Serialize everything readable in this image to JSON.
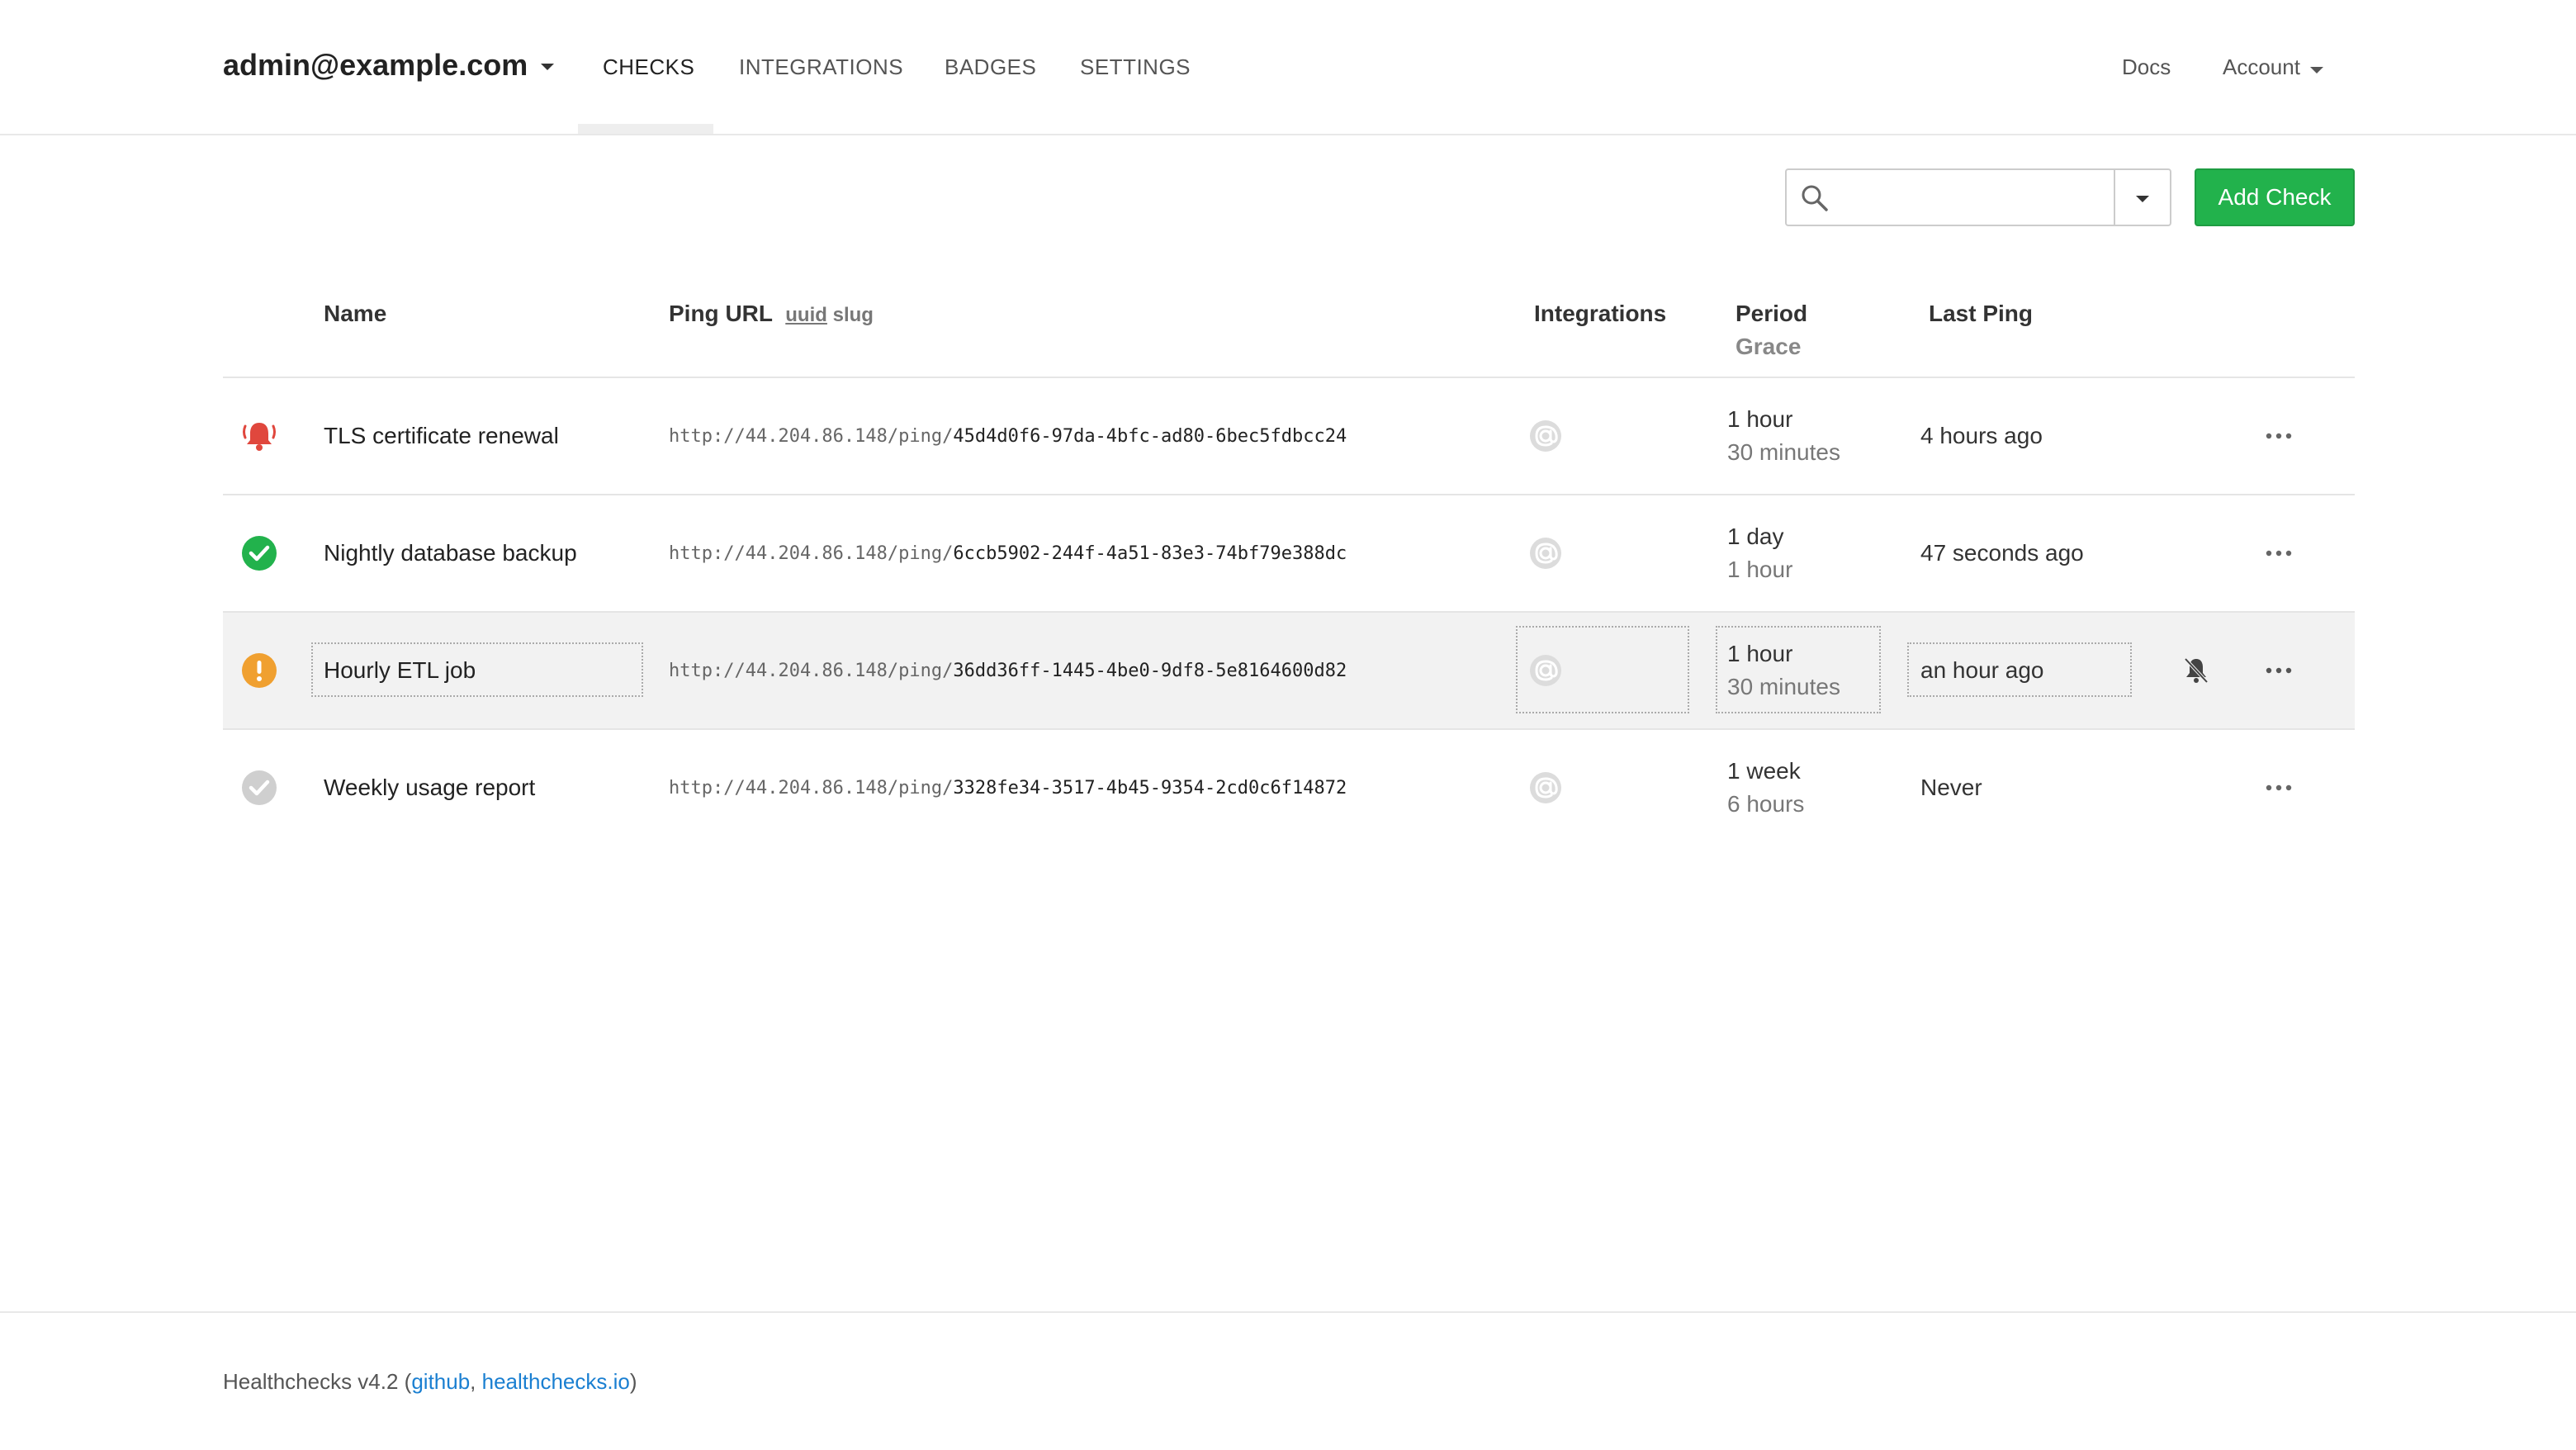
{
  "navbar": {
    "brand": "admin@example.com",
    "tabs": [
      "CHECKS",
      "INTEGRATIONS",
      "BADGES",
      "SETTINGS"
    ],
    "active_tab": "CHECKS",
    "docs": "Docs",
    "account": "Account"
  },
  "toolbar": {
    "search_value": "",
    "search_placeholder": "",
    "add_check": "Add Check",
    "accent_color": "#22b24c"
  },
  "table": {
    "headers": {
      "name": "Name",
      "ping_url": "Ping URL",
      "url_uuid": "uuid",
      "url_slug": "slug",
      "integrations": "Integrations",
      "period": "Period",
      "grace": "Grace",
      "last_ping": "Last Ping"
    },
    "rows": [
      {
        "status": "down",
        "status_icon": "bell-alert-icon",
        "status_color": "#e0473d",
        "name": "TLS certificate renewal",
        "url_base": "http://44.204.86.148/ping/",
        "url_id": "45d4d0f6-97da-4bfc-ad80-6bec5fdbcc24",
        "period": "1 hour",
        "grace": "30 minutes",
        "last_ping": "4 hours ago"
      },
      {
        "status": "up",
        "status_icon": "check-circle-icon",
        "status_color": "#22b24c",
        "name": "Nightly database backup",
        "url_base": "http://44.204.86.148/ping/",
        "url_id": "6ccb5902-244f-4a51-83e3-74bf79e388dc",
        "period": "1 day",
        "grace": "1 hour",
        "last_ping": "47 seconds ago"
      },
      {
        "status": "grace",
        "status_icon": "exclamation-circle-icon",
        "status_color": "#f0a030",
        "name": "Hourly ETL job",
        "url_base": "http://44.204.86.148/ping/",
        "url_id": "36dd36ff-1445-4be0-9df8-5e8164600d82",
        "period": "1 hour",
        "grace": "30 minutes",
        "last_ping": "an hour ago"
      },
      {
        "status": "new",
        "status_icon": "check-circle-grey-icon",
        "status_color": "#cccccc",
        "name": "Weekly usage report",
        "url_base": "http://44.204.86.148/ping/",
        "url_id": "3328fe34-3517-4b45-9354-2cd0c6f14872",
        "period": "1 week",
        "grace": "6 hours",
        "last_ping": "Never"
      }
    ]
  },
  "footer": {
    "prefix": "Healthchecks v4.2 (",
    "github": "github",
    "sep": ", ",
    "site": "healthchecks.io",
    "suffix": ")"
  }
}
